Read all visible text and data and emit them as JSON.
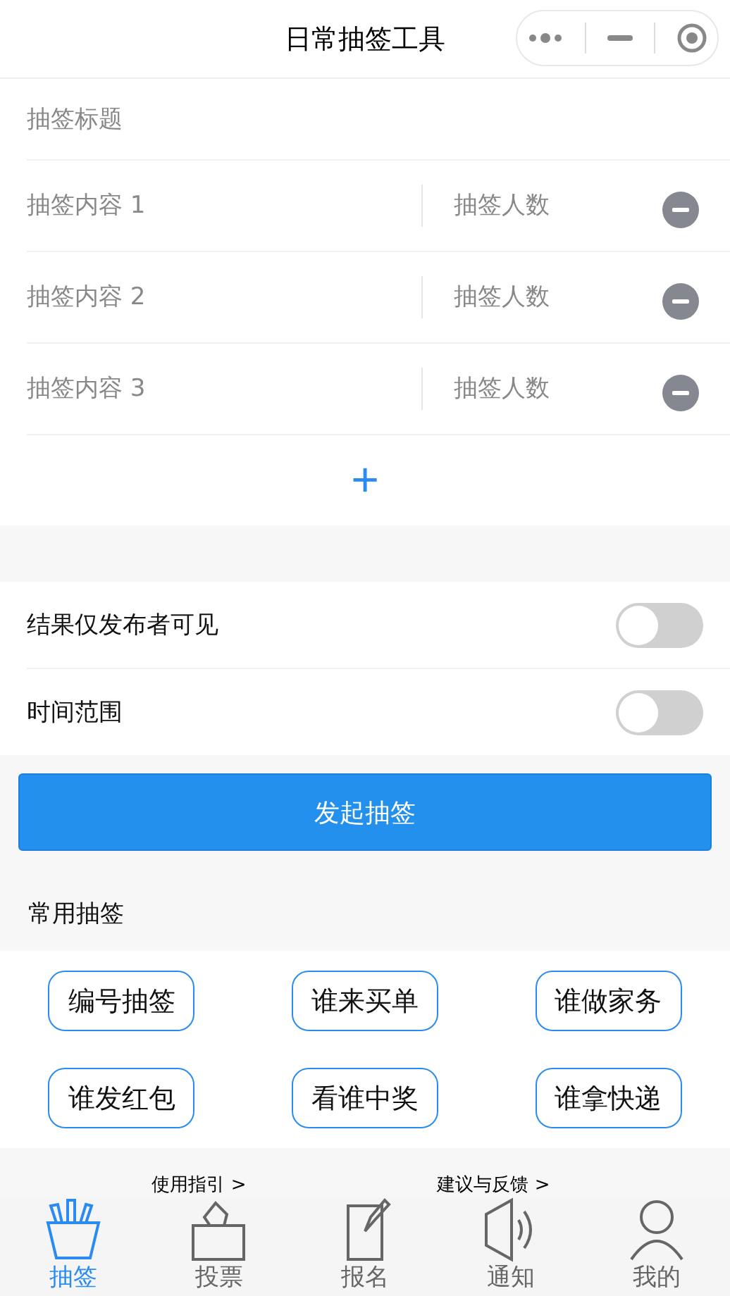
{
  "nav": {
    "title": "日常抽签工具"
  },
  "form": {
    "title_placeholder": "抽签标题",
    "items": [
      {
        "content_placeholder": "抽签内容 1",
        "count_placeholder": "抽签人数"
      },
      {
        "content_placeholder": "抽签内容 2",
        "count_placeholder": "抽签人数"
      },
      {
        "content_placeholder": "抽签内容 3",
        "count_placeholder": "抽签人数"
      }
    ],
    "add": "+"
  },
  "settings": [
    {
      "label": "结果仅发布者可见",
      "on": false
    },
    {
      "label": "时间范围",
      "on": false
    }
  ],
  "submit": "发起抽签",
  "presets": {
    "title": "常用抽签",
    "items": [
      "编号抽签",
      "谁来买单",
      "谁做家务",
      "谁发红包",
      "看谁中奖",
      "谁拿快递"
    ]
  },
  "links": [
    "使用指引 >",
    "建议与反馈 >"
  ],
  "tabs": [
    {
      "label": "抽签",
      "kind": "draw",
      "selected": true
    },
    {
      "label": "投票",
      "kind": "vote",
      "selected": false
    },
    {
      "label": "报名",
      "kind": "signup",
      "selected": false
    },
    {
      "label": "通知",
      "kind": "notice",
      "selected": false
    },
    {
      "label": "我的",
      "kind": "me",
      "selected": false
    }
  ]
}
